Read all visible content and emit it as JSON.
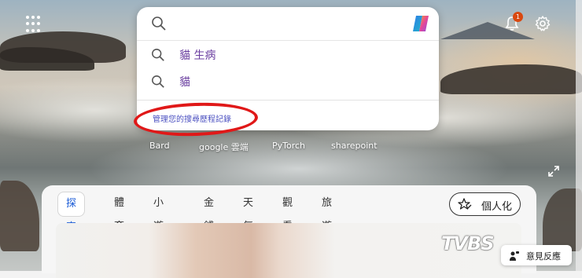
{
  "search": {
    "value": "",
    "placeholder": "",
    "suggestions": [
      {
        "text": "貓 生病"
      },
      {
        "text": "貓"
      }
    ],
    "manage_history_label": "管理您的搜尋歷程記錄"
  },
  "notifications": {
    "count": "1"
  },
  "quick_links": [
    {
      "label": "Bard"
    },
    {
      "label": "google 雲端"
    },
    {
      "label": "PyTorch"
    },
    {
      "label": "sharepoint"
    }
  ],
  "feed": {
    "tabs": [
      {
        "label": "探索",
        "active": true
      },
      {
        "label": "體育"
      },
      {
        "label": "小遊戲"
      },
      {
        "label": "金錢"
      },
      {
        "label": "天氣"
      },
      {
        "label": "觀看"
      },
      {
        "label": "旅遊"
      }
    ],
    "personalize_label": "個人化",
    "image_watermark": "TVBS"
  },
  "feedback": {
    "label": "意見反應"
  },
  "colors": {
    "accent": "#1a5bd6",
    "suggestion_text": "#6b3fa0",
    "link": "#4a4fc0",
    "annotation": "#e01818",
    "badge": "#d9480f"
  },
  "icons": {
    "apps": "apps-grid-icon",
    "bell": "bell-icon",
    "gear": "gear-icon",
    "search": "search-icon",
    "copilot": "copilot-icon",
    "expand": "expand-icon",
    "personalize": "star-pen-icon",
    "feedback": "feedback-icon"
  }
}
